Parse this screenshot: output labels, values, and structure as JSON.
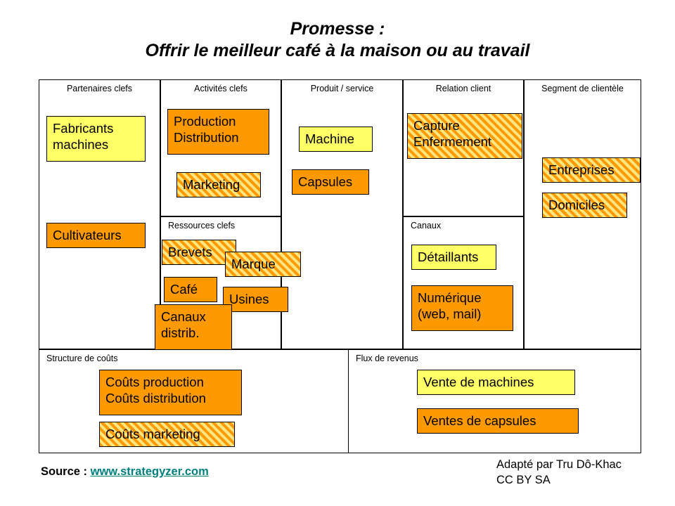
{
  "title": {
    "line1": "Promesse :",
    "line2": "Offrir le meilleur café à la maison ou au travail"
  },
  "canvas": {
    "sections": {
      "partenaires": "Partenaires clefs",
      "activites": "Activités clefs",
      "ressources": "Ressources clefs",
      "produit": "Produit / service",
      "relation": "Relation client",
      "canaux": "Canaux",
      "segment": "Segment de clientèle",
      "couts": "Structure de coûts",
      "revenus": "Flux de revenus"
    },
    "notes": {
      "fabricants_machines": "Fabricants\nmachines",
      "cultivateurs": "Cultivateurs",
      "production_distribution": "Production\nDistribution",
      "marketing": "Marketing",
      "brevets": "Brevets",
      "marque": "Marque",
      "cafe": "Café",
      "usines": "Usines",
      "canaux_distrib": "Canaux\ndistrib.",
      "machine": "Machine",
      "capsules": "Capsules",
      "capture_enfermement": "Capture\nEnfermement",
      "detaillants": "Détaillants",
      "numerique": "Numérique\n(web, mail)",
      "entreprises": "Entreprises",
      "domiciles": "Domiciles",
      "couts_production": "Coûts production\nCoûts distribution",
      "couts_marketing": "Coûts marketing",
      "vente_machines": "Vente de machines",
      "ventes_capsules": "Ventes de capsules"
    }
  },
  "footer": {
    "source_label": "Source :",
    "source_link": "www.strategyzer.com",
    "credit": "Adapté par Tru Dô-Khac\nCC BY SA"
  },
  "colors": {
    "solid_orange": "#FF9900",
    "solid_yellow": "#FFFF66",
    "hatch_base": "#FFE680",
    "hatch_stripe": "#FF9900",
    "link": "#008080",
    "border": "#000000"
  }
}
